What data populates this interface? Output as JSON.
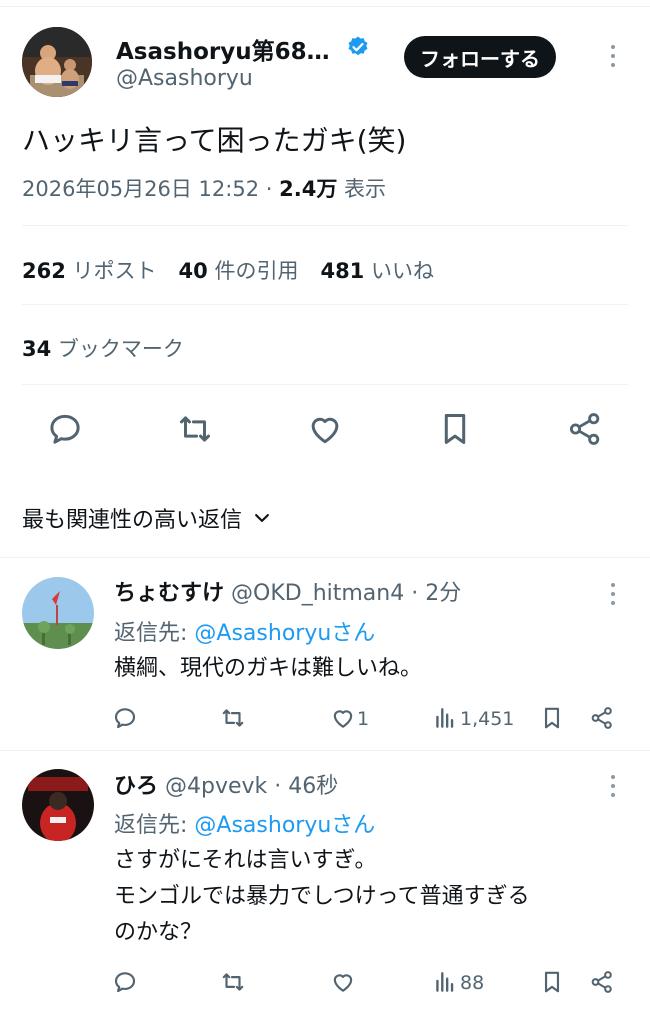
{
  "tweet": {
    "display_name": "Asashoryu第68…",
    "handle": "@Asashoryu",
    "follow_label": "フォローする",
    "text": "ハッキリ言って困ったガキ(笑)",
    "datetime": "2026年05月26日 12:52",
    "separator": "·",
    "views_count": "2.4万",
    "views_label": "表示",
    "reposts_count": "262",
    "reposts_label": "リポスト",
    "quotes_count": "40",
    "quotes_label": "件の引用",
    "likes_count": "481",
    "likes_label": "いいね",
    "bookmarks_count": "34",
    "bookmarks_label": "ブックマーク"
  },
  "sort": {
    "label": "最も関連性の高い返信"
  },
  "replies": [
    {
      "display_name": "ちょむすけ",
      "handle": "@OKD_hitman4",
      "time": "· 2分",
      "reply_to_prefix": "返信先:",
      "reply_to_handle": "@Asashoryuさん",
      "lines": [
        "横綱、現代のガキは難しいね。"
      ],
      "likes": "1",
      "views": "1,451"
    },
    {
      "display_name": "ひろ",
      "handle": "@4pvevk",
      "time": "· 46秒",
      "reply_to_prefix": "返信先:",
      "reply_to_handle": "@Asashoryuさん",
      "lines": [
        "さすがにそれは言いすぎ。",
        "モンゴルでは暴力でしつけって普通すぎる",
        "のかな？"
      ],
      "likes": "",
      "views": "88"
    }
  ],
  "colors": {
    "accent": "#1d9bf0",
    "text": "#0f1419",
    "muted": "#536471",
    "divider": "#eff3f4",
    "verified": "#1d9bf0"
  },
  "icons": [
    "verified-badge-icon",
    "more-icon",
    "reply-icon",
    "repost-icon",
    "like-icon",
    "bookmark-icon",
    "share-icon",
    "views-icon",
    "chevron-down-icon"
  ]
}
